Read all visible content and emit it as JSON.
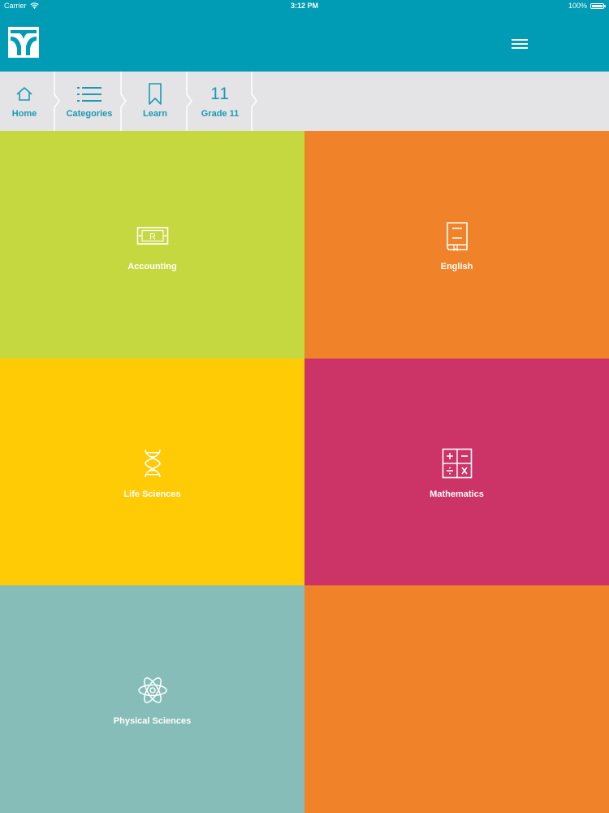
{
  "status_bar": {
    "carrier": "Carrier",
    "time": "3:12 PM",
    "battery": "100%"
  },
  "app_bar": {
    "logo_icon": "brand-logo-icon",
    "menu_icon": "hamburger-menu-icon",
    "color": "#009bb4"
  },
  "breadcrumb": {
    "items": [
      {
        "label": "Home",
        "icon": "home-icon"
      },
      {
        "label": "Categories",
        "icon": "list-icon"
      },
      {
        "label": "Learn",
        "icon": "bookmark-icon"
      },
      {
        "label": "Grade 11",
        "icon_text": "11"
      }
    ]
  },
  "subjects": [
    {
      "label": "Accounting",
      "icon": "banknote-icon",
      "color": "#c5d840"
    },
    {
      "label": "English",
      "icon": "book-icon",
      "color": "#f0822a"
    },
    {
      "label": "Life Sciences",
      "icon": "dna-icon",
      "color": "#ffcb05"
    },
    {
      "label": "Mathematics",
      "icon": "calculator-icon",
      "color": "#cc3366"
    },
    {
      "label": "Physical Sciences",
      "icon": "atom-icon",
      "color": "#87bdb9"
    },
    {
      "label": "",
      "icon": "",
      "color": "#f0822a"
    }
  ]
}
